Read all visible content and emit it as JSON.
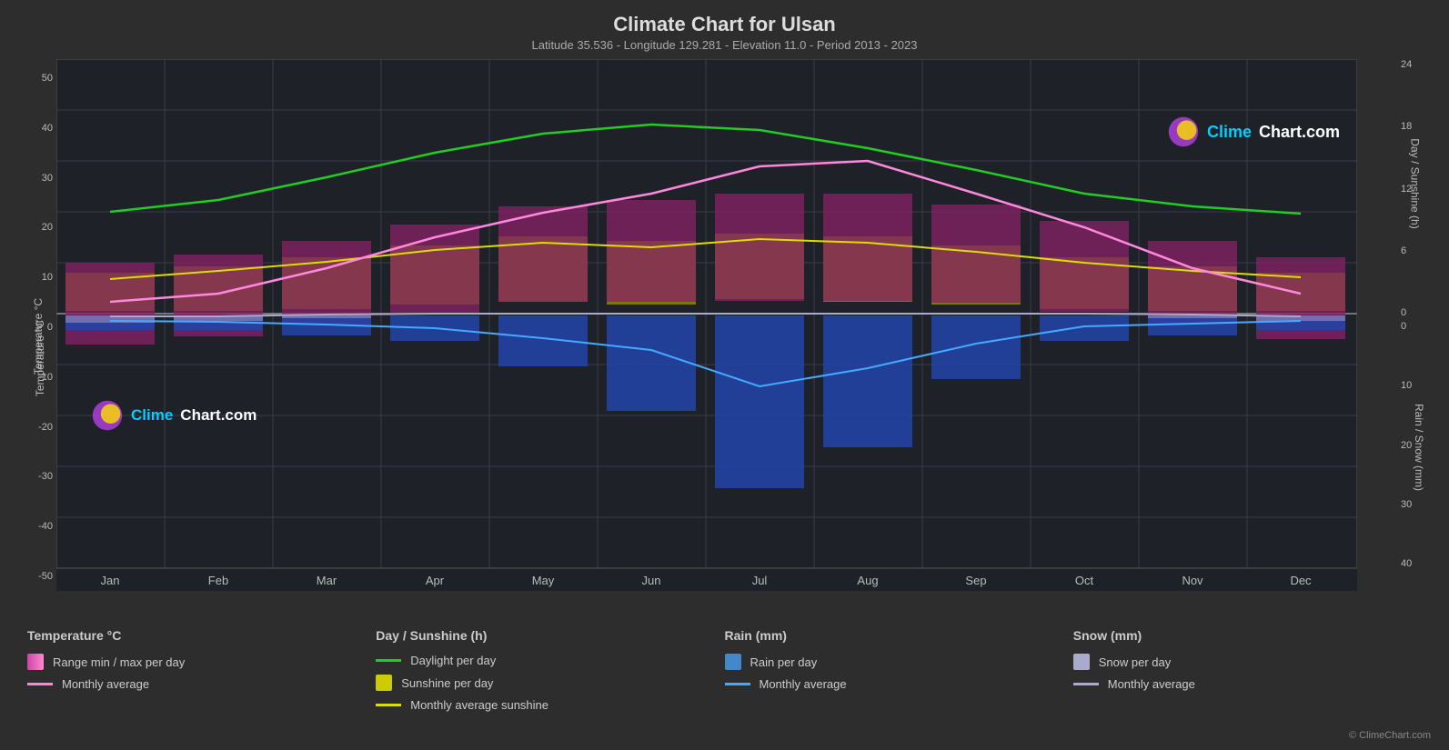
{
  "page": {
    "title": "Climate Chart for Ulsan",
    "subtitle": "Latitude 35.536 - Longitude 129.281 - Elevation 11.0 - Period 2013 - 2023"
  },
  "chart": {
    "y_left_label": "Temperature °C",
    "y_right_top_label": "Day / Sunshine (h)",
    "y_right_bottom_label": "Rain / Snow (mm)",
    "y_left_ticks": [
      "50",
      "40",
      "30",
      "20",
      "10",
      "0",
      "-10",
      "-20",
      "-30",
      "-40",
      "-50"
    ],
    "y_right_ticks_top": [
      "24",
      "18",
      "12",
      "6",
      "0"
    ],
    "y_right_ticks_bottom": [
      "0",
      "10",
      "20",
      "30",
      "40"
    ],
    "x_months": [
      "Jan",
      "Feb",
      "Mar",
      "Apr",
      "May",
      "Jun",
      "Jul",
      "Aug",
      "Sep",
      "Oct",
      "Nov",
      "Dec"
    ]
  },
  "legend": {
    "col1": {
      "heading": "Temperature °C",
      "items": [
        {
          "type": "rect",
          "color": "#cc44aa",
          "label": "Range min / max per day"
        },
        {
          "type": "line",
          "color": "#ff88cc",
          "label": "Monthly average"
        }
      ]
    },
    "col2": {
      "heading": "Day / Sunshine (h)",
      "items": [
        {
          "type": "line",
          "color": "#44cc44",
          "label": "Daylight per day"
        },
        {
          "type": "rect",
          "color": "#cccc00",
          "label": "Sunshine per day"
        },
        {
          "type": "line",
          "color": "#dddd00",
          "label": "Monthly average sunshine"
        }
      ]
    },
    "col3": {
      "heading": "Rain (mm)",
      "items": [
        {
          "type": "rect",
          "color": "#4488cc",
          "label": "Rain per day"
        },
        {
          "type": "line",
          "color": "#4499dd",
          "label": "Monthly average"
        }
      ]
    },
    "col4": {
      "heading": "Snow (mm)",
      "items": [
        {
          "type": "rect",
          "color": "#aaaacc",
          "label": "Snow per day"
        },
        {
          "type": "line",
          "color": "#aaaacc",
          "label": "Monthly average"
        }
      ]
    }
  },
  "logo": {
    "text": "ClimeChart.com"
  },
  "copyright": "© ClimeChart.com"
}
